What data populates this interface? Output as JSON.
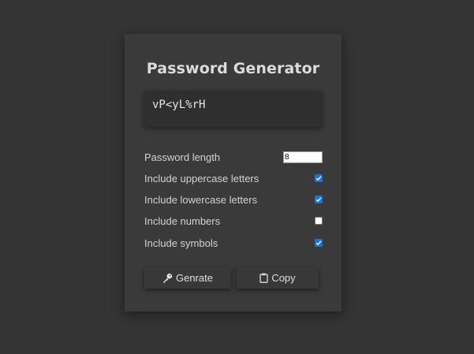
{
  "app": {
    "title": "Password Generator"
  },
  "result": {
    "password": "vP<yL%rH"
  },
  "options": {
    "length": {
      "label": "Password length",
      "value": "8"
    },
    "uppercase": {
      "label": "Include uppercase letters",
      "checked": true
    },
    "lowercase": {
      "label": "Include lowercase letters",
      "checked": true
    },
    "numbers": {
      "label": "Include numbers",
      "checked": false
    },
    "symbols": {
      "label": "Include symbols",
      "checked": true
    }
  },
  "buttons": {
    "generate": {
      "label": "Genrate",
      "icon": "key-icon"
    },
    "copy": {
      "label": "Copy",
      "icon": "clipboard-icon"
    }
  },
  "colors": {
    "background": "#343434",
    "card": "#3a3a3a",
    "checkbox_accent": "#1976d2"
  }
}
